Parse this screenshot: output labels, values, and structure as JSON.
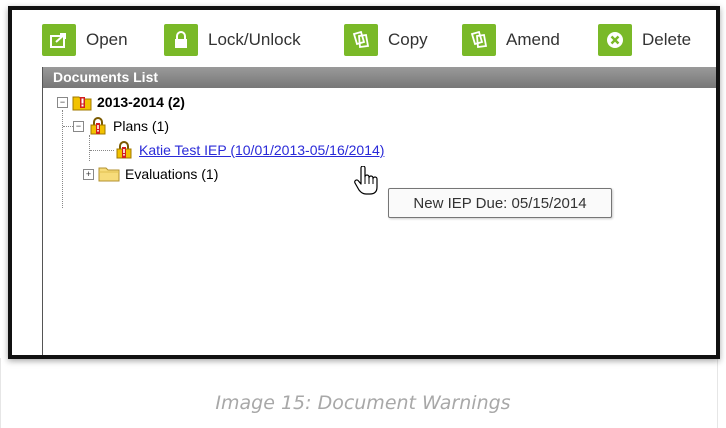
{
  "toolbar": {
    "open_label": "Open",
    "lock_label": "Lock/Unlock",
    "copy_label": "Copy",
    "amend_label": "Amend",
    "delete_label": "Delete"
  },
  "panel": {
    "title": "Documents List"
  },
  "tree": {
    "year_node": "2013-2014 (2)",
    "plans_node": "Plans (1)",
    "document_link": "Katie Test IEP (10/01/2013-05/16/2014)",
    "evaluations_node": "Evaluations (1)"
  },
  "tooltip": {
    "text": "New IEP Due: 05/15/2014"
  },
  "caption": "Image 15: Document Warnings",
  "colors": {
    "toolbar_icon_bg": "#7ab928",
    "panel_header": "#888888",
    "link": "#2a2ad8",
    "warning_red": "#d21f1f",
    "lock_yellow": "#f2c200"
  }
}
